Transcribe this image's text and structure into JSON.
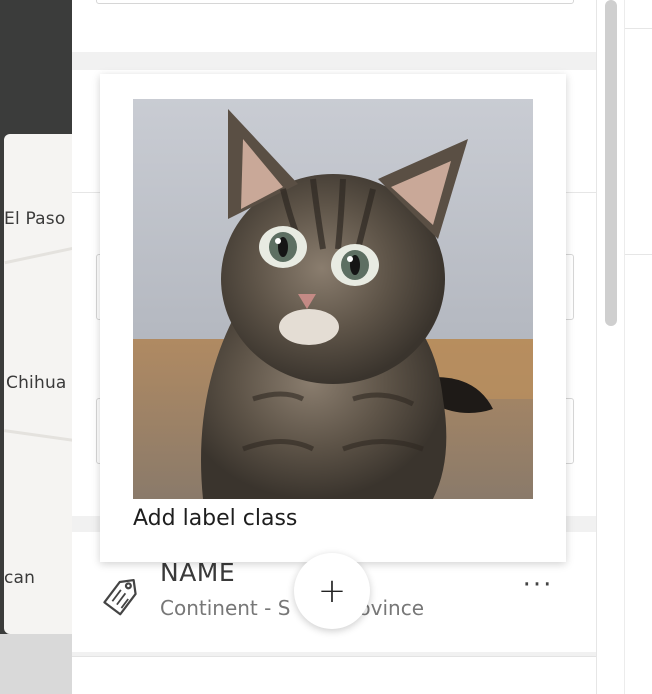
{
  "map": {
    "places": [
      "El Paso",
      "Chihua",
      "can"
    ]
  },
  "label_class": {
    "name": "NAME",
    "subtitle": "Continent - S",
    "subtitle_tail": "ovince",
    "more_label": "…",
    "icon": "tag-icon"
  },
  "tooltip": {
    "text": "Add label class",
    "image": "kitten-photo"
  },
  "add_button": {
    "label": "+",
    "icon": "plus-icon"
  },
  "colors": {
    "map_dark": "#3b3c3b",
    "panel_bg": "#f1f1f1",
    "scrollbar_thumb": "#cfcfcf"
  }
}
